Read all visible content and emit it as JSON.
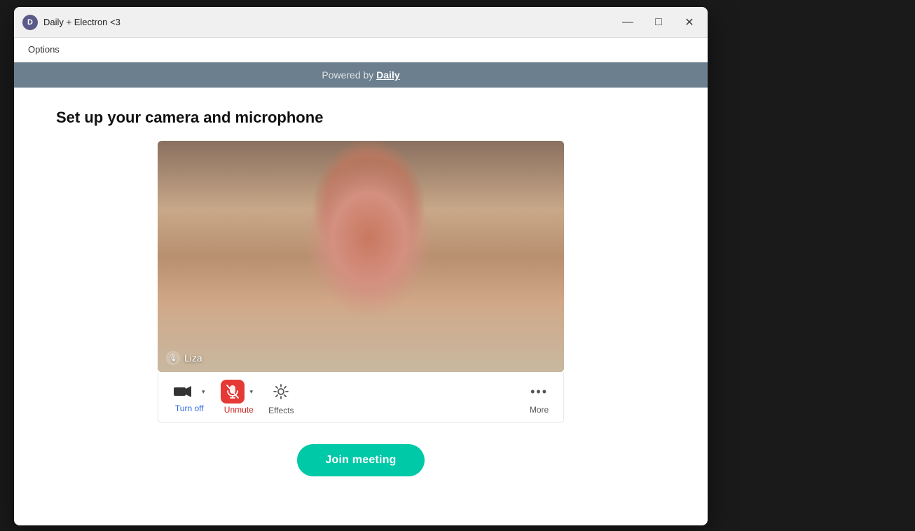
{
  "window": {
    "title": "Daily + Electron <3",
    "icon_label": "D",
    "minimize_label": "—",
    "maximize_label": "□",
    "close_label": "✕"
  },
  "options_bar": {
    "options_label": "Options"
  },
  "powered_bar": {
    "text_prefix": "Powered by ",
    "link_text": "Daily"
  },
  "main": {
    "setup_title": "Set up your camera and microphone",
    "video_person_name": "Liza"
  },
  "controls": {
    "turn_off_label": "Turn off",
    "unmute_label": "Unmute",
    "effects_label": "Effects",
    "more_label": "More"
  },
  "join": {
    "button_label": "Join meeting"
  },
  "colors": {
    "powered_bar_bg": "#6b7f8f",
    "join_btn_bg": "#00c9a7",
    "unmute_red": "#e53935",
    "accent_blue": "#2d6be4"
  }
}
